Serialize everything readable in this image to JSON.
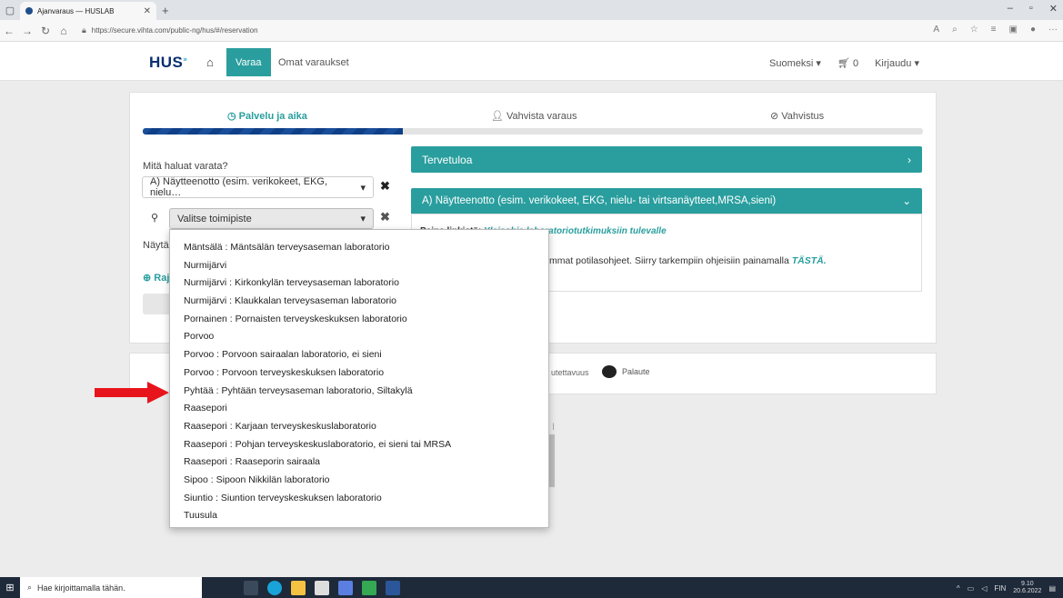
{
  "browser": {
    "tab_title": "Ajanvaraus — HUSLAB",
    "url": "https://secure.vihta.com/public-ng/hus/#/reservation"
  },
  "header": {
    "logo": "HUS",
    "nav_varaa": "Varaa",
    "nav_omat": "Omat varaukset",
    "language": "Suomeksi ▾",
    "cart_count": "0",
    "login": "Kirjaudu ▾"
  },
  "steps": {
    "step1": "Palvelu ja aika",
    "step2": "Vahvista varaus",
    "step3": "Vahvistus",
    "progress": 0.33
  },
  "form": {
    "what_label": "Mitä haluat varata?",
    "service_value": "A) Näytteenotto (esim. verikokeet, EKG, nielu…",
    "location_placeholder": "Valitse toimipiste",
    "nayta_label": "Näytä",
    "rajaa_label": "Raj"
  },
  "panels": {
    "welcome": "Tervetuloa",
    "service_title": "A) Näytteenotto (esim. verikokeet, EKG, nielu- tai virtsanäytteet,MRSA,sieni)",
    "body_line1_prefix": "Paina linkistä:",
    "body_line1_link": "Yleisohje laboratoriotutkimuksiin tulevalle",
    "body_line2": "mmat potilasohjeet. Siirry tarkempiin ohjeisiin painamalla",
    "body_line2_link": "TÄSTÄ."
  },
  "footer": {
    "accessibility_fragment": "utettavuus",
    "feedback": "Palaute"
  },
  "dropdown_items": [
    "Mäntsälä : Mäntsälän terveysaseman laboratorio",
    "Nurmijärvi",
    "Nurmijärvi : Kirkonkylän terveysaseman laboratorio",
    "Nurmijärvi : Klaukkalan terveysaseman laboratorio",
    "Pornainen : Pornaisten terveyskeskuksen laboratorio",
    "Porvoo",
    "Porvoo : Porvoon sairaalan laboratorio, ei sieni",
    "Porvoo : Porvoon terveyskeskuksen laboratorio",
    "Pyhtää : Pyhtään terveysaseman laboratorio, Siltakylä",
    "Raasepori",
    "Raasepori : Karjaan terveyskeskuslaboratorio",
    "Raasepori : Pohjan terveyskeskuslaboratorio, ei sieni tai MRSA",
    "Raasepori : Raaseporin sairaala",
    "Sipoo : Sipoon Nikkilän laboratorio",
    "Siuntio : Siuntion terveyskeskuksen laboratorio",
    "Tuusula"
  ],
  "taskbar": {
    "search_placeholder": "Hae kirjoittamalla tähän.",
    "lang": "FIN",
    "time": "9.10",
    "date": "20.6.2022"
  },
  "colors": {
    "teal": "#2a9e9e",
    "navy": "#0f3f86",
    "arrow": "#e8141c"
  }
}
